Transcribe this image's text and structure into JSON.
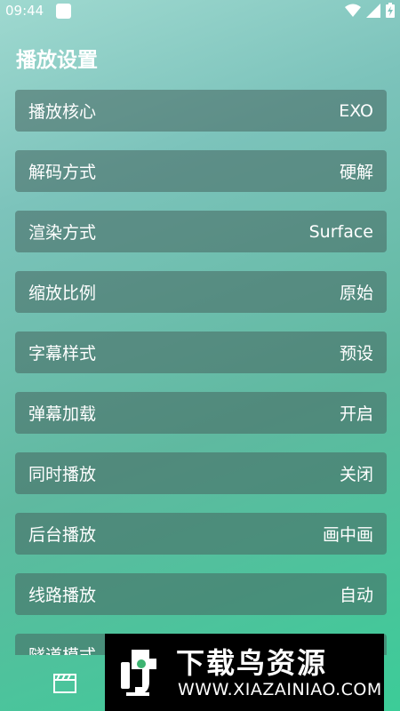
{
  "status": {
    "time": "09:44",
    "icons": [
      "wifi-icon",
      "signal-icon",
      "battery-charging-icon"
    ]
  },
  "page": {
    "title": "播放设置"
  },
  "settings": [
    {
      "label": "播放核心",
      "value": "EXO"
    },
    {
      "label": "解码方式",
      "value": "硬解"
    },
    {
      "label": "渲染方式",
      "value": "Surface"
    },
    {
      "label": "缩放比例",
      "value": "原始"
    },
    {
      "label": "字幕样式",
      "value": "预设"
    },
    {
      "label": "弹幕加载",
      "value": "开启"
    },
    {
      "label": "同时播放",
      "value": "关闭"
    },
    {
      "label": "后台播放",
      "value": "画中画"
    },
    {
      "label": "线路播放",
      "value": "自动"
    },
    {
      "label": "隧道模式",
      "value": ""
    }
  ],
  "bottom_nav": {
    "icons": [
      "clapperboard-icon"
    ]
  },
  "watermark": {
    "title": "下载鸟资源",
    "url": "WWW.XIAZAINIAO.COM"
  }
}
